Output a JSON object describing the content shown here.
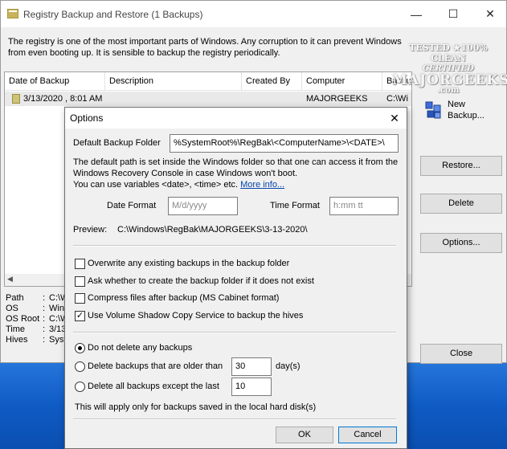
{
  "window": {
    "title": "Registry Backup and Restore  (1 Backups)",
    "minimize": "—",
    "maximize": "☐",
    "close": "✕"
  },
  "intro": {
    "line1": "The registry is one of the most important parts of Windows. Any corruption to it can prevent Windows",
    "line2": "from even booting up.  It is sensible to backup the registry periodically."
  },
  "list": {
    "columns": [
      "Date of Backup",
      "Description",
      "Created By",
      "Computer",
      "Backu"
    ],
    "rows": [
      {
        "date": "3/13/2020 , 8:01 AM",
        "description": "",
        "created_by": "",
        "computer": "MAJORGEEKS",
        "backup": "C:\\Wi"
      }
    ],
    "scroll_left": "◀"
  },
  "details": [
    {
      "label": "Path",
      "value": "C:\\W"
    },
    {
      "label": "OS",
      "value": "Wind"
    },
    {
      "label": "OS Root",
      "value": "C:\\W"
    },
    {
      "label": "Time",
      "value": "3/13"
    },
    {
      "label": "Hives",
      "value": "Syst"
    }
  ],
  "buttons": {
    "new_backup_line1": "New",
    "new_backup_line2": "Backup...",
    "restore": "Restore...",
    "delete": "Delete",
    "options": "Options...",
    "close": "Close"
  },
  "watermark": {
    "line1": "TESTED ★100% CLEAN",
    "line2": "CERTIFIED",
    "line3": "MAJORGEEKS",
    "line4": ".com"
  },
  "options_dialog": {
    "title": "Options",
    "close": "✕",
    "default_folder_label": "Default Backup Folder",
    "default_folder_value": "%SystemRoot%\\RegBak\\<ComputerName>\\<DATE>\\",
    "help_line1": "The default path is set inside the Windows folder so that one can access it from the",
    "help_line2": "Windows Recovery Console in case Windows won't boot.",
    "help_line3": "You can use variables <date>, <time> etc. ",
    "more_info": "More info...",
    "date_format_label": "Date Format",
    "date_format_placeholder": "M/d/yyyy",
    "time_format_label": "Time Format",
    "time_format_placeholder": "h:mm tt",
    "preview_label": "Preview:",
    "preview_value": "C:\\Windows\\RegBak\\MAJORGEEKS\\3-13-2020\\",
    "checkboxes": [
      {
        "label": "Overwrite any existing backups in the backup folder",
        "checked": false
      },
      {
        "label": "Ask whether to create the backup folder if it does not exist",
        "checked": false
      },
      {
        "label": "Compress files after backup (MS Cabinet format)",
        "checked": false
      },
      {
        "label": "Use Volume Shadow Copy Service to backup the hives",
        "checked": true
      }
    ],
    "radios": [
      {
        "label": "Do not delete any backups",
        "selected": true
      },
      {
        "label": "Delete backups that are older than",
        "selected": false
      },
      {
        "label": "Delete all backups except the last",
        "selected": false
      }
    ],
    "older_than_value": "30",
    "older_than_unit": "day(s)",
    "keep_last_value": "10",
    "note": "This will apply only for backups saved in the local hard disk(s)",
    "ok": "OK",
    "cancel": "Cancel"
  }
}
